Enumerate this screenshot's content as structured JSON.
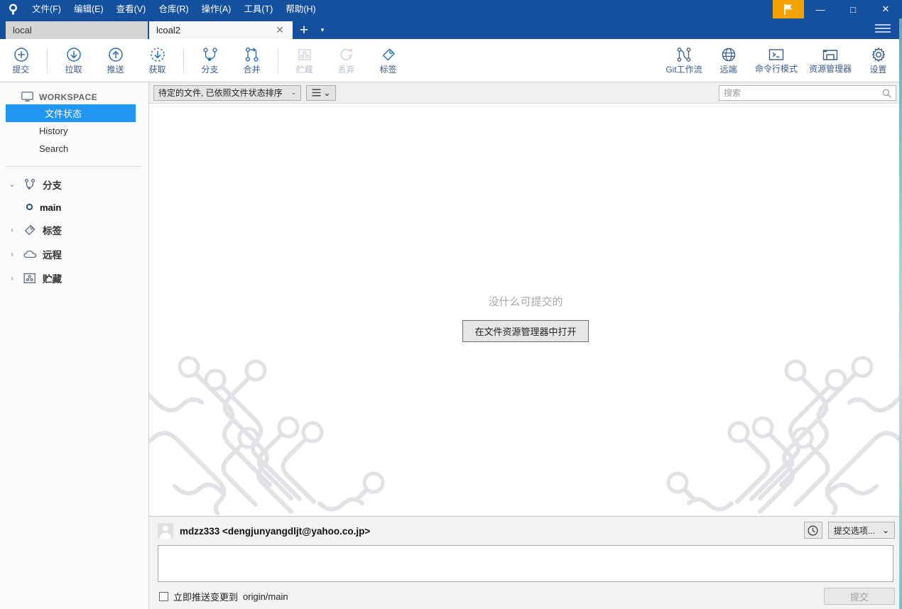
{
  "titlebar": {
    "logo_icon": "sourcetree-logo-icon",
    "menus": [
      {
        "label": "文件(F)",
        "name": "menu-file"
      },
      {
        "label": "编辑(E)",
        "name": "menu-edit"
      },
      {
        "label": "查看(V)",
        "name": "menu-view"
      },
      {
        "label": "仓库(R)",
        "name": "menu-repository"
      },
      {
        "label": "操作(A)",
        "name": "menu-actions"
      },
      {
        "label": "工具(T)",
        "name": "menu-tools"
      },
      {
        "label": "帮助(H)",
        "name": "menu-help"
      }
    ],
    "flag_icon": "flag-icon",
    "minimize": "—",
    "maximize": "□",
    "close": "✕",
    "accent_color": "#15509e",
    "flag_color": "#f5a302"
  },
  "tabs": {
    "items": [
      {
        "label": "local",
        "active": false
      },
      {
        "label": "lcoal2",
        "active": true
      }
    ],
    "close_glyph": "✕",
    "add_glyph": "+",
    "caret_glyph": "▾"
  },
  "toolbar": {
    "left": [
      {
        "label": "提交",
        "icon": "commit-plus-icon",
        "disabled": false
      },
      {
        "label": "拉取",
        "icon": "pull-down-arrow-icon",
        "disabled": false
      },
      {
        "label": "推送",
        "icon": "push-up-arrow-icon",
        "disabled": false
      },
      {
        "label": "获取",
        "icon": "fetch-dashed-arrow-icon",
        "disabled": false
      },
      {
        "label": "分支",
        "icon": "branch-icon",
        "disabled": false
      },
      {
        "label": "合并",
        "icon": "merge-icon",
        "disabled": false
      },
      {
        "label": "贮藏",
        "icon": "stash-icon",
        "disabled": true
      },
      {
        "label": "丢弃",
        "icon": "discard-reset-icon",
        "disabled": true
      },
      {
        "label": "标签",
        "icon": "tag-icon",
        "disabled": false
      }
    ],
    "right": [
      {
        "label": "Git工作流",
        "icon": "gitflow-icon"
      },
      {
        "label": "远端",
        "icon": "globe-remote-icon"
      },
      {
        "label": "命令行模式",
        "icon": "terminal-icon"
      },
      {
        "label": "资源管理器",
        "icon": "explorer-folder-icon"
      },
      {
        "label": "设置",
        "icon": "gear-settings-icon"
      }
    ]
  },
  "sidebar": {
    "workspace_label": "WORKSPACE",
    "workspace_icon": "monitor-icon",
    "items": [
      {
        "label": "文件状态",
        "selected": true
      },
      {
        "label": "History",
        "selected": false
      },
      {
        "label": "Search",
        "selected": false
      }
    ],
    "tree": [
      {
        "label": "分支",
        "icon": "branch-icon",
        "expanded": true,
        "chevron": "⌄"
      },
      {
        "label": "标签",
        "icon": "tag-icon",
        "expanded": false,
        "chevron": "›"
      },
      {
        "label": "远程",
        "icon": "cloud-icon",
        "expanded": false,
        "chevron": "›"
      },
      {
        "label": "贮藏",
        "icon": "stash-icon",
        "expanded": false,
        "chevron": "›"
      }
    ],
    "branch": {
      "label": "main",
      "icon": "branch-dot-icon"
    },
    "selected_color": "#2196f3"
  },
  "filterbar": {
    "sort_label": "待定的文件, 已依照文件状态排序",
    "caret": "⌄",
    "view_icon": "list-view-icon",
    "view_caret": "⌄"
  },
  "search": {
    "placeholder": "搜索",
    "value": "",
    "icon": "search-icon"
  },
  "empty_state": {
    "message": "没什么可提交的",
    "button_label": "在文件资源管理器中打开"
  },
  "commit_panel": {
    "author": "mdzz333 <dengjunyangdljt@yahoo.co.jp>",
    "avatar_icon": "user-avatar-icon",
    "history_icon": "clock-history-icon",
    "options_label": "提交选项...",
    "options_caret": "⌄",
    "message_value": "",
    "push_checkbox_label_prefix": "立即推送变更到",
    "push_checkbox_target": "origin/main",
    "push_checked": false,
    "commit_button_label": "提交",
    "commit_button_disabled": true
  }
}
